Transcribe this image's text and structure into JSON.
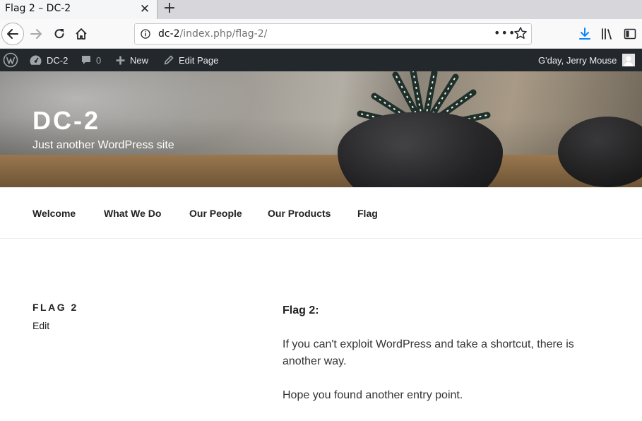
{
  "browser": {
    "tab_title": "Flag 2 – DC-2",
    "tab_close": "✕",
    "new_tab": "+",
    "url_host": "dc-2",
    "url_path": "/index.php/flag-2/",
    "page_actions": "•••"
  },
  "adminbar": {
    "site_name": "DC-2",
    "comments_count": "0",
    "new_label": "New",
    "edit_label": "Edit Page",
    "greeting": "G'day, Jerry Mouse"
  },
  "site": {
    "title": "DC-2",
    "description": "Just another WordPress site"
  },
  "menu": {
    "items": [
      {
        "label": "Welcome"
      },
      {
        "label": "What We Do"
      },
      {
        "label": "Our People"
      },
      {
        "label": "Our Products"
      },
      {
        "label": "Flag"
      }
    ]
  },
  "page": {
    "title": "FLAG 2",
    "edit_link": "Edit",
    "heading": "Flag 2:",
    "paragraph1": "If you can't exploit WordPress and take a shortcut, there is another way.",
    "paragraph2": "Hope you found another entry point."
  },
  "colors": {
    "adminbar_bg": "#23282d",
    "download_icon": "#0a84ff"
  }
}
